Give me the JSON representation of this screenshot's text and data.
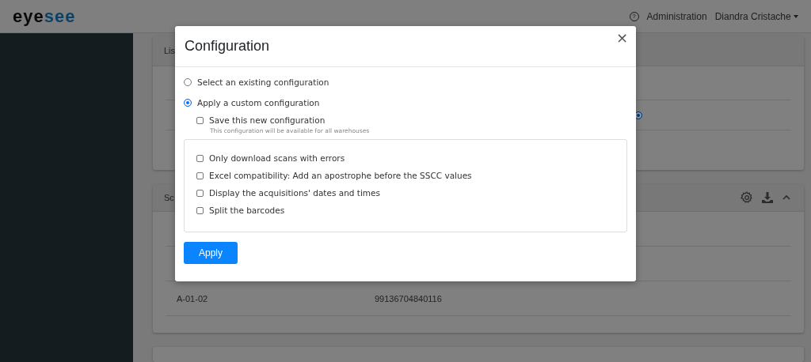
{
  "header": {
    "logo_dark": "eye",
    "logo_light": "see",
    "help_icon": "?",
    "admin_link": "Administration",
    "user_menu": "Diandra Cristache"
  },
  "background": {
    "list_card": {
      "title": "Lis",
      "radio_selected": true
    },
    "scans_card": {
      "title": "Sc",
      "rows": [
        {
          "location": "",
          "code": ""
        },
        {
          "location": "",
          "code": ""
        },
        {
          "location": "A-01-02",
          "code": "99136704840116"
        }
      ]
    }
  },
  "modal": {
    "title": "Configuration",
    "close": "×",
    "modes": [
      {
        "label": "Select an existing configuration",
        "selected": false
      },
      {
        "label": "Apply a custom configuration",
        "selected": true
      }
    ],
    "save": {
      "label": "Save this new configuration",
      "checked": false,
      "hint": "This configuration will be available for all warehouses"
    },
    "options": [
      {
        "label": "Only download scans with errors",
        "checked": false
      },
      {
        "label": "Excel compatibility: Add an apostrophe before the SSCC values",
        "checked": false
      },
      {
        "label": "Display the acquisitions' dates and times",
        "checked": false
      },
      {
        "label": "Split the barcodes",
        "checked": false
      }
    ],
    "apply": "Apply"
  }
}
